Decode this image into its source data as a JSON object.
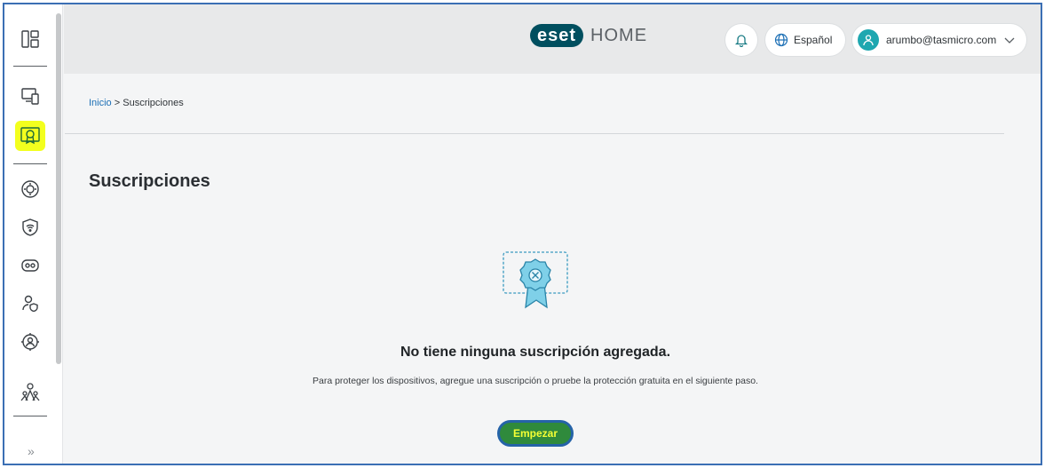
{
  "header": {
    "logo_text": "eset",
    "logo_suffix": "HOME",
    "language": "Español",
    "user_email": "arumbo@tasmicro.com"
  },
  "breadcrumb": {
    "home": "Inicio",
    "separator": ">",
    "current": "Suscripciones"
  },
  "page": {
    "title": "Suscripciones",
    "empty_title": "No tiene ninguna suscripción agregada.",
    "empty_description": "Para proteger los dispositivos, agregue una suscripción o pruebe la protección gratuita en el siguiente paso.",
    "start_button": "Empezar"
  },
  "sidebar": {
    "items": [
      {
        "icon": "dashboard-icon"
      },
      {
        "icon": "devices-icon"
      },
      {
        "icon": "subscriptions-icon",
        "active": true
      },
      {
        "icon": "security-settings-icon"
      },
      {
        "icon": "wifi-shield-icon"
      },
      {
        "icon": "password-manager-icon"
      },
      {
        "icon": "user-shield-icon"
      },
      {
        "icon": "anti-theft-icon"
      },
      {
        "icon": "family-icon"
      }
    ],
    "expand": "»"
  },
  "colors": {
    "accent": "#1c6fb5",
    "highlight": "#f3ff1e",
    "button_bg": "#2f8a3c"
  }
}
